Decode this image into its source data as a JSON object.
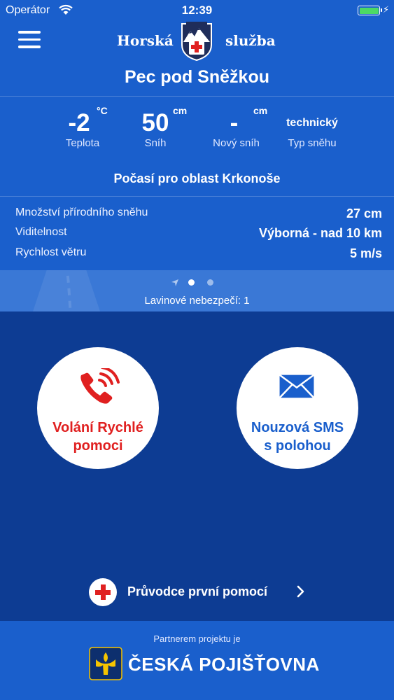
{
  "status_bar": {
    "carrier": "Operátor",
    "time": "12:39",
    "battery_icon": "battery-icon",
    "wifi_icon": "wifi-icon"
  },
  "header": {
    "brand_left": "Horská",
    "brand_right": "služba",
    "location": "Pec pod Sněžkou",
    "menu_icon": "hamburger-menu-icon"
  },
  "stats": [
    {
      "value": "-2",
      "unit": "°C",
      "label": "Teplota"
    },
    {
      "value": "50",
      "unit": "cm",
      "label": "Sníh"
    },
    {
      "value": "-",
      "unit": "cm",
      "label": "Nový sníh"
    },
    {
      "value": "technický",
      "label": "Typ sněhu"
    }
  ],
  "weather": {
    "title": "Počasí pro oblast Krkonoše",
    "rows": [
      {
        "key": "Množství přírodního sněhu",
        "value": "27 cm"
      },
      {
        "key": "Viditelnost",
        "value": "Výborná - nad 10 km"
      },
      {
        "key": "Rychlost větru",
        "value": "5 m/s"
      }
    ]
  },
  "avalanche": {
    "text": "Lavinové nebezpečí: 1",
    "pages": 2,
    "active_page": 1
  },
  "actions": {
    "call_line1": "Volání Rychlé",
    "call_line2": "pomoci",
    "sms_line1": "Nouzová SMS",
    "sms_line2": "s polohou",
    "first_aid": "Průvodce první pomocí"
  },
  "footer": {
    "partner": "Partnerem projektu je",
    "sponsor": "ČESKÁ POJIŠŤOVNA"
  },
  "colors": {
    "header_blue": "#1a5fcc",
    "body_blue": "#0d3c93",
    "emergency_red": "#e02020",
    "battery_green": "#4cd964"
  }
}
